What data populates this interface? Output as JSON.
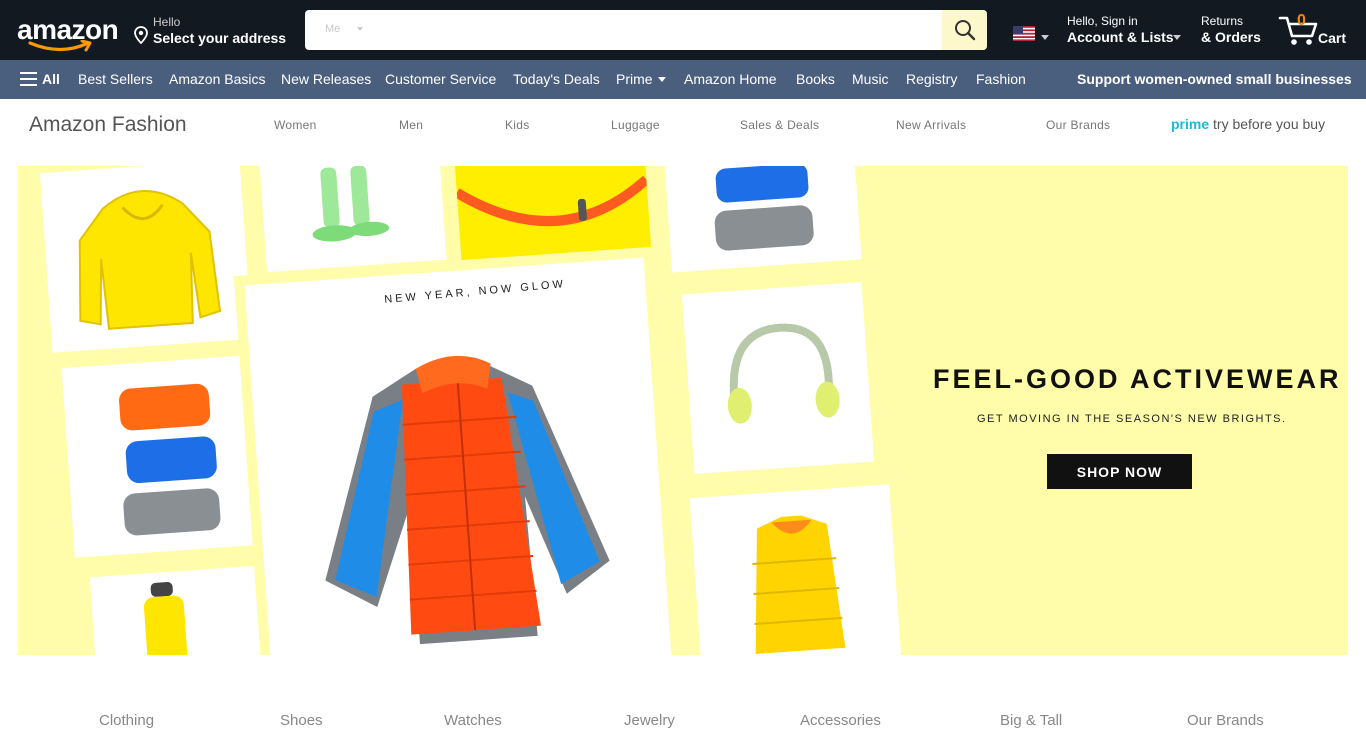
{
  "header": {
    "logo": "amazon",
    "address_line1": "Hello",
    "address_line2": "Select your address",
    "search_dept": "Me",
    "search_placeholder": "",
    "account_line1": "Hello, Sign in",
    "account_line2": "Account & Lists",
    "returns_line1": "Returns",
    "returns_line2": "& Orders",
    "cart_count": "0",
    "cart_label": "Cart"
  },
  "subnav": {
    "all": "All",
    "items": [
      "Best Sellers",
      "Amazon Basics",
      "New Releases",
      "Customer Service",
      "Today's Deals",
      "Prime",
      "Amazon Home",
      "Books",
      "Music",
      "Registry",
      "Fashion"
    ],
    "promo": "Support women-owned small businesses"
  },
  "fashion_nav": {
    "title": "Amazon Fashion",
    "links": [
      "Women",
      "Men",
      "Kids",
      "Luggage",
      "Sales & Deals",
      "New Arrivals",
      "Our Brands"
    ],
    "prime_word": "prime",
    "prime_rest": "try before you buy"
  },
  "hero": {
    "tagline": "NEW YEAR, NOW GLOW",
    "headline": "FEEL-GOOD ACTIVEWEAR",
    "subline": "GET MOVING IN THE SEASON'S NEW BRIGHTS.",
    "cta": "SHOP NOW"
  },
  "categories": [
    "Clothing",
    "Shoes",
    "Watches",
    "Jewelry",
    "Accessories",
    "Big & Tall",
    "Our Brands"
  ],
  "colors": {
    "topbar": "#131921",
    "subnav": "#4a5f7e",
    "hero_bg": "#fffcaa",
    "cart_count": "#f08804",
    "prime": "#1bbbd8"
  }
}
